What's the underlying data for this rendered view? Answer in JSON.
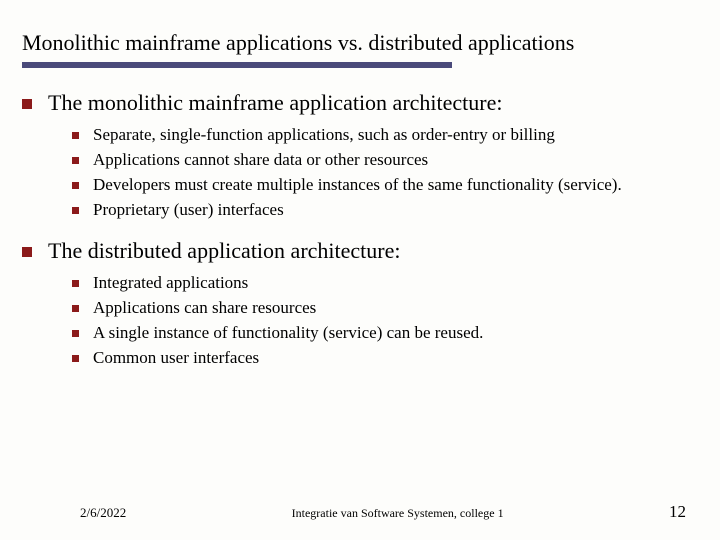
{
  "title": "Monolithic mainframe applications vs. distributed applications",
  "sections": [
    {
      "heading": "The monolithic mainframe application architecture:",
      "items": [
        "Separate, single-function applications, such as order-entry or billing",
        "Applications cannot share data or other resources",
        "Developers must create multiple instances of the same functionality (service).",
        "Proprietary (user) interfaces"
      ]
    },
    {
      "heading": "The distributed application architecture:",
      "items": [
        "Integrated applications",
        "Applications can share resources",
        "A single instance of functionality (service) can be reused.",
        "Common user interfaces"
      ]
    }
  ],
  "footer": {
    "date": "2/6/2022",
    "course": "Integratie van Software Systemen, college 1",
    "page": "12"
  }
}
